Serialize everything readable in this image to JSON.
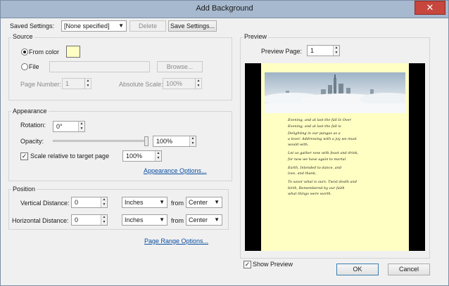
{
  "window": {
    "title": "Add Background",
    "close_symbol": "✕"
  },
  "saved_settings": {
    "label": "Saved Settings:",
    "value": "[None specified]",
    "delete_label": "Delete",
    "save_label": "Save Settings..."
  },
  "source": {
    "title": "Source",
    "from_color_label": "From color",
    "swatch_color": "#ffffc4",
    "file_label": "File",
    "browse_label": "Browse...",
    "page_number_label": "Page Number:",
    "page_number_value": "1",
    "absolute_scale_label": "Absolute Scale:",
    "absolute_scale_value": "100%"
  },
  "appearance": {
    "title": "Appearance",
    "rotation_label": "Rotation:",
    "rotation_value": "0°",
    "opacity_label": "Opacity:",
    "opacity_value": "100%",
    "opacity_fraction": 1.0,
    "scale_label": "Scale relative to target page",
    "scale_value": "100%",
    "options_link": "Appearance Options..."
  },
  "position": {
    "title": "Position",
    "vertical_label": "Vertical Distance:",
    "vertical_value": "0",
    "vertical_unit": "Inches",
    "vertical_from_label": "from",
    "vertical_anchor": "Center",
    "horizontal_label": "Horizontal Distance:",
    "horizontal_value": "0",
    "horizontal_unit": "Inches",
    "horizontal_from_label": "from",
    "horizontal_anchor": "Center"
  },
  "page_range_link": "Page Range Options...",
  "preview": {
    "title": "Preview",
    "page_label": "Preview Page:",
    "page_value": "1",
    "show_preview_label": "Show Preview",
    "poem_lines": [
      "Evening, and at last the fall Is Over",
      "Evening, and at last the fall is",
      "Delighting in our pangas as a",
      "a lover, Addressing with a joy we must",
      "would with.",
      "Let us gather now with feast and drink,",
      "for now we have again to mortal",
      "Earth, Intended to dance, and",
      "love, and thank,",
      "To savor what is ours. Twixt death and",
      "birth, Remembered by our faith",
      "what things were worth."
    ]
  },
  "buttons": {
    "ok_label": "OK",
    "cancel_label": "Cancel"
  }
}
